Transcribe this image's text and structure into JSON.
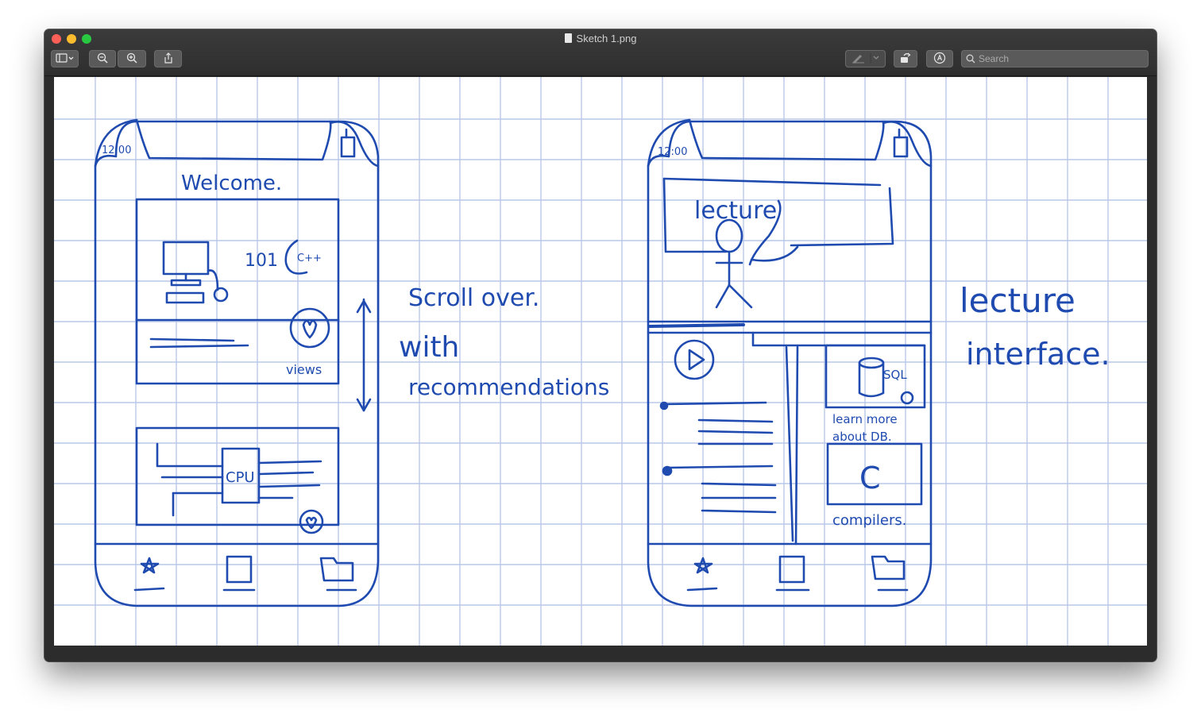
{
  "window": {
    "title": "Sketch 1.png"
  },
  "toolbar": {
    "search_placeholder": "Search"
  },
  "colors": {
    "ink": "#1f4bb0",
    "grid": "#b9c7e8",
    "toolbar": "#2e2e2e"
  },
  "sketch": {
    "left_phone": {
      "time": "12:00",
      "welcome": "Welcome.",
      "course_code": "101",
      "course_lang": "C++",
      "views": "views",
      "cpu": "CPU"
    },
    "left_note": {
      "line1": "Scroll over.",
      "line2": "with",
      "line3": "recommendations"
    },
    "right_phone": {
      "time": "12:00",
      "lecture": "lecture",
      "sql": "SQL",
      "learn_more": "learn more",
      "about_db": "about DB.",
      "c_letter": "C",
      "compilers": "compilers."
    },
    "right_note": {
      "line1": "lecture",
      "line2": "interface."
    }
  }
}
